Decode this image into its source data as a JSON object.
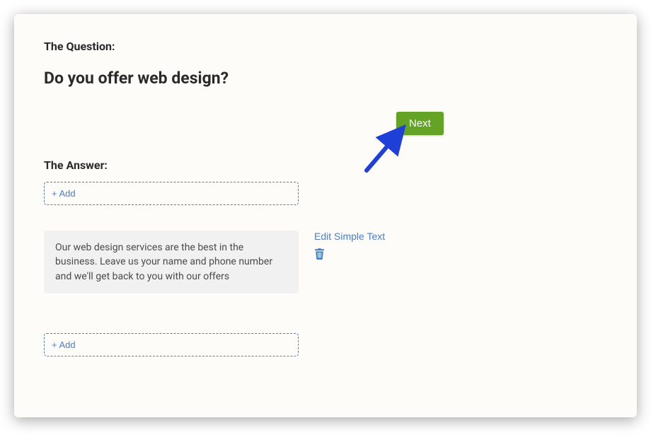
{
  "question": {
    "label": "The Question:",
    "text": "Do you offer web design?"
  },
  "answer": {
    "label": "The Answer:",
    "add_label": "+ Add",
    "card_text": "Our web design services are the best in the business. Leave us your name and phone number and we'll get back to you with our offers",
    "edit_link": "Edit Simple Text"
  },
  "next_button": "Next",
  "colors": {
    "accent_blue": "#4a7ec9",
    "success_green": "#64a325",
    "arrow_blue": "#1f3fd9"
  }
}
